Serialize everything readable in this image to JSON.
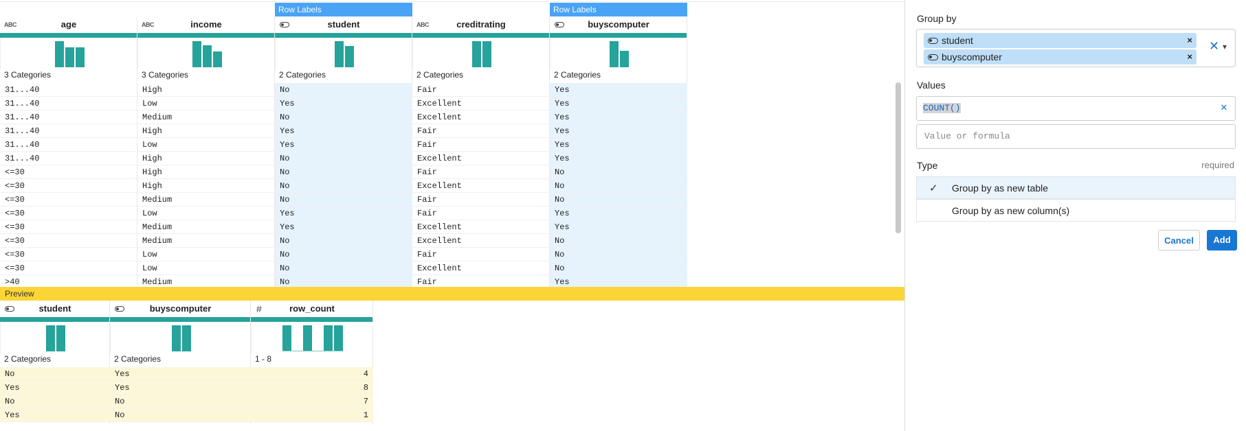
{
  "row_labels_tag": "Row Labels",
  "main_table": {
    "columns": [
      {
        "name": "age",
        "type": "abc",
        "summary": "3 Categories",
        "highlight": false,
        "bars": [
          0.95,
          0.72,
          0.72
        ]
      },
      {
        "name": "income",
        "type": "abc",
        "summary": "3 Categories",
        "highlight": false,
        "bars": [
          0.95,
          0.8,
          0.58
        ]
      },
      {
        "name": "student",
        "type": "bool",
        "summary": "2 Categories",
        "highlight": true,
        "bars": [
          0.95,
          0.78
        ]
      },
      {
        "name": "creditrating",
        "type": "abc",
        "summary": "2 Categories",
        "highlight": false,
        "bars": [
          0.95,
          0.95
        ]
      },
      {
        "name": "buyscomputer",
        "type": "bool",
        "summary": "2 Categories",
        "highlight": true,
        "bars": [
          0.95,
          0.6
        ]
      }
    ],
    "rows": [
      [
        "31...40",
        "High",
        "No",
        "Fair",
        "Yes"
      ],
      [
        "31...40",
        "Low",
        "Yes",
        "Excellent",
        "Yes"
      ],
      [
        "31...40",
        "Medium",
        "No",
        "Excellent",
        "Yes"
      ],
      [
        "31...40",
        "High",
        "Yes",
        "Fair",
        "Yes"
      ],
      [
        "31...40",
        "Low",
        "Yes",
        "Fair",
        "Yes"
      ],
      [
        "31...40",
        "High",
        "No",
        "Excellent",
        "Yes"
      ],
      [
        "<=30",
        "High",
        "No",
        "Fair",
        "No"
      ],
      [
        "<=30",
        "High",
        "No",
        "Excellent",
        "No"
      ],
      [
        "<=30",
        "Medium",
        "No",
        "Fair",
        "No"
      ],
      [
        "<=30",
        "Low",
        "Yes",
        "Fair",
        "Yes"
      ],
      [
        "<=30",
        "Medium",
        "Yes",
        "Excellent",
        "Yes"
      ],
      [
        "<=30",
        "Medium",
        "No",
        "Excellent",
        "No"
      ],
      [
        "<=30",
        "Low",
        "No",
        "Fair",
        "No"
      ],
      [
        "<=30",
        "Low",
        "No",
        "Excellent",
        "No"
      ],
      [
        ">40",
        "Medium",
        "No",
        "Fair",
        "Yes"
      ]
    ]
  },
  "preview": {
    "label": "Preview",
    "columns": [
      {
        "name": "student",
        "type": "bool",
        "summary": "2 Categories",
        "bars": [
          0.95,
          0.95
        ]
      },
      {
        "name": "buyscomputer",
        "type": "bool",
        "summary": "2 Categories",
        "bars": [
          0.95,
          0.95
        ]
      },
      {
        "name": "row_count",
        "type": "num",
        "summary": "1 - 8",
        "bars": [
          0.95,
          0,
          0.95,
          0,
          0.95,
          0.95
        ]
      }
    ],
    "rows": [
      [
        "No",
        "Yes",
        "4"
      ],
      [
        "Yes",
        "Yes",
        "8"
      ],
      [
        "No",
        "No",
        "7"
      ],
      [
        "Yes",
        "No",
        "1"
      ]
    ]
  },
  "sidebar": {
    "group_by_label": "Group by",
    "group_by_items": [
      "student",
      "buyscomputer"
    ],
    "values_label": "Values",
    "value_formula": "COUNT()",
    "value_placeholder": "Value or formula",
    "type_label": "Type",
    "required_label": "required",
    "type_options": [
      {
        "label": "Group by as new table",
        "selected": true
      },
      {
        "label": "Group by as new column(s)",
        "selected": false
      }
    ],
    "cancel_label": "Cancel",
    "add_label": "Add"
  }
}
